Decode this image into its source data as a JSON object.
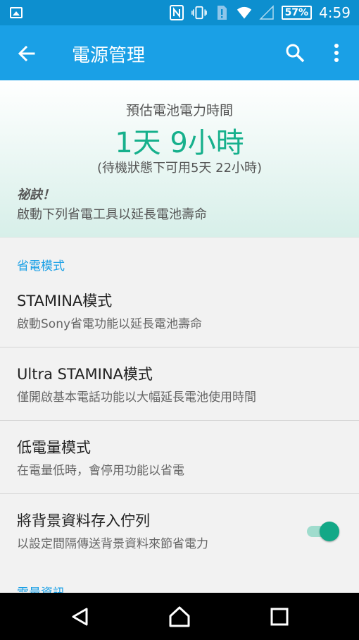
{
  "status_bar": {
    "battery_percent": "57%",
    "time": "4:59",
    "icons": [
      "gallery-icon",
      "nfc-icon",
      "vibrate-icon",
      "sim-alert-icon",
      "wifi-icon",
      "signal-icon",
      "battery-icon"
    ]
  },
  "app_bar": {
    "title": "電源管理",
    "icons": [
      "back-arrow-icon",
      "search-icon",
      "more-vert-icon"
    ]
  },
  "summary": {
    "estimate_label": "預估電池電力時間",
    "estimate_value": "1天 9小時",
    "standby_text": "(待機狀態下可用5天 22小時)",
    "tip_title": "祕訣！",
    "tip_body": "啟動下列省電工具以延長電池壽命"
  },
  "sections": [
    {
      "header": "省電模式",
      "items": [
        {
          "title": "STAMINA模式",
          "subtitle": "啟動Sony省電功能以延長電池壽命"
        },
        {
          "title": "Ultra STAMINA模式",
          "subtitle": "僅開啟基本電話功能以大幅延長電池使用時間"
        },
        {
          "title": "低電量模式",
          "subtitle": "在電量低時，會停用功能以省電"
        },
        {
          "title": "將背景資料存入佇列",
          "subtitle": "以設定間隔傳送背景資料來節省電力",
          "toggle_on": true
        }
      ]
    },
    {
      "header": "電量資訊"
    }
  ],
  "colors": {
    "status_bar": "#0d8fcf",
    "app_bar": "#1aa0e6",
    "accent_green": "#16b08c",
    "section_header": "#1aa0e6",
    "toggle_thumb": "#13a887"
  },
  "nav_bar": {
    "icons": [
      "back-triangle-icon",
      "home-icon",
      "recents-icon"
    ]
  }
}
